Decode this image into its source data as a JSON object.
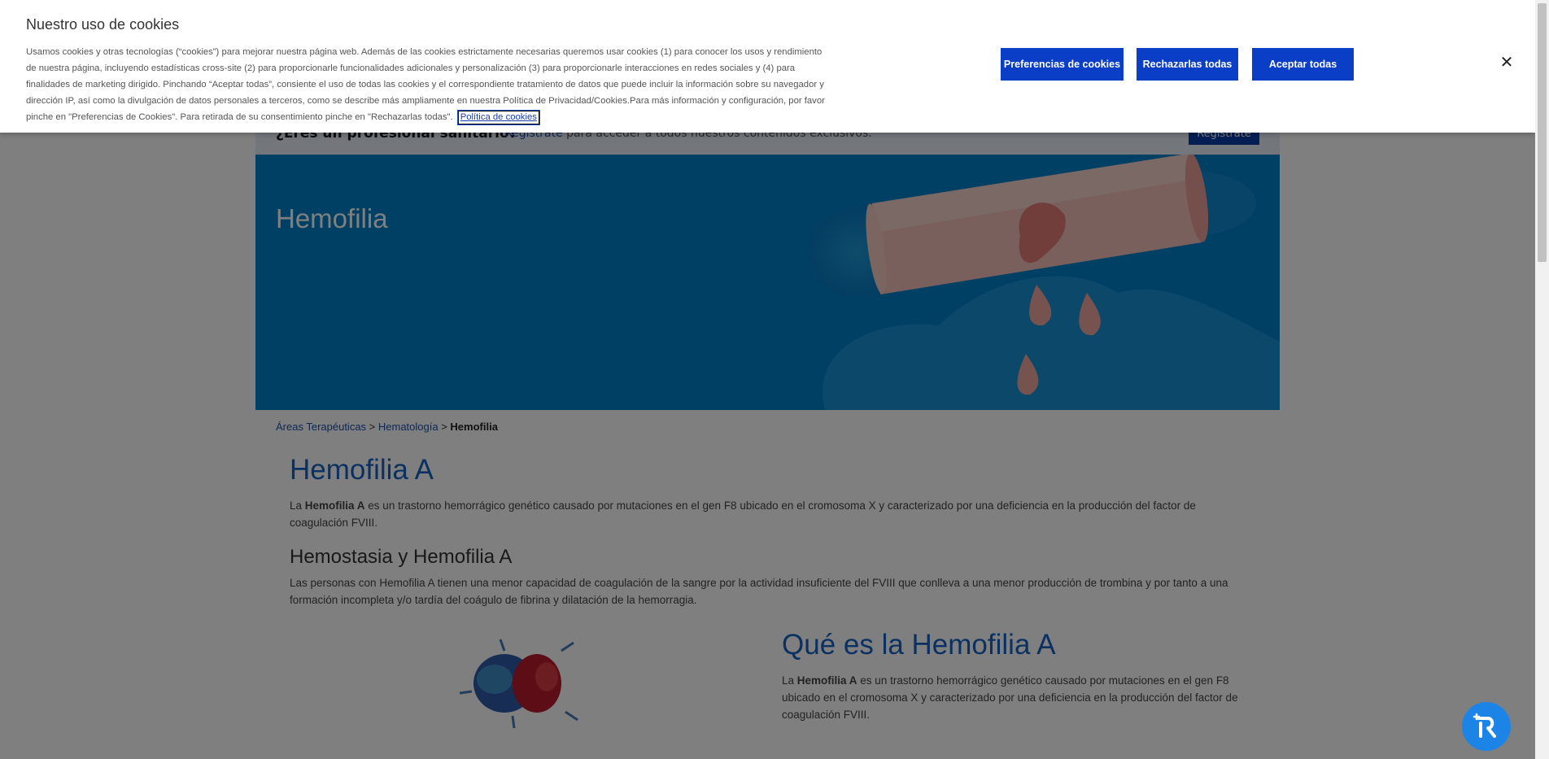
{
  "cookie_banner": {
    "title": "Nuestro uso de cookies",
    "body": "Usamos cookies y otras tecnologías (“cookies”) para mejorar nuestra página web. Además de las cookies estrictamente necesarias queremos usar cookies (1) para conocer los usos y rendimiento de nuestra página, incluyendo estadísticas cross-site (2) para proporcionarle funcionalidades adicionales y personalización (3) para proporcionarle interacciones en redes sociales y (4) para finalidades de marketing dirigido. Pinchando “Aceptar todas”, consiente el uso de todas las cookies y el correspondiente tratamiento de datos que puede incluir la información sobre su navegador y dirección IP, así como la divulgación de datos personales a terceros, como se describe más ampliamente en nuestra Política de Privacidad/Cookies.Para más información y configuración, por favor pinche en \"Preferencias de Cookies\". Para retirada de su consentimiento pinche en \"Rechazarlas todas\".",
    "policy_link": "Política de cookies",
    "buttons": {
      "preferences": "Preferencias de cookies",
      "reject_all": "Rechazarlas todas",
      "accept_all": "Aceptar todas"
    },
    "close_icon": "close-icon",
    "close_glyph": "✕"
  },
  "hcp_bar": {
    "question": "¿Eres un profesional sanitario?",
    "link": "Regístrate",
    "text": " para acceder a todos nuestros contenidos exclusivos.",
    "button": "Regístrate"
  },
  "hero": {
    "title": "Hemofilia"
  },
  "breadcrumb": {
    "item1": "Áreas Terapéuticas",
    "sep1": " > ",
    "item2": "Hematología",
    "sep2": " > ",
    "current": "Hemofilia"
  },
  "content": {
    "heading1": "Hemofilia A",
    "intro_pre": "La ",
    "intro_bold": "Hemofilia A",
    "intro_post": " es un trastorno hemorrágico genético causado por mutaciones en el gen F8 ubicado en el cromosoma X y caracterizado por una deficiencia en la producción del factor de coagulación FVIII.",
    "heading2": "Hemostasia y Hemofilia A",
    "hemostasia_text": "Las personas con Hemofilia A tienen una menor capacidad de coagulación de la sangre por la actividad insuficiente del FVIII que conlleva a una menor producción de trombina y por tanto a una formación incompleta y/o tardía del coágulo de fibrina y dilatación de la hemorragia.",
    "heading3": "Qué es la Hemofilia A",
    "que_pre": "La ",
    "que_bold": "Hemofilia A",
    "que_post": " es un trastorno hemorrágico genético causado por mutaciones en el gen F8 ubicado en el cromosoma X y caracterizado por una deficiencia en la producción del factor de coagulación FVIII."
  },
  "colors": {
    "accent": "#0b3ec7",
    "heading_blue": "#1563c4",
    "hero_bg": "#0080c8",
    "fab": "#1b84e6"
  }
}
